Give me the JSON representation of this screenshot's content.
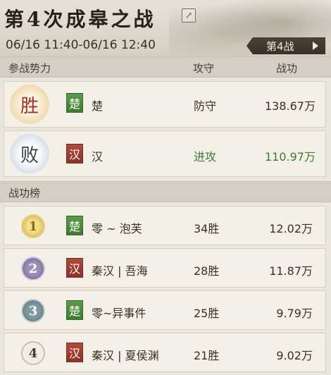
{
  "header": {
    "title": "第4次成皋之战",
    "time_range": "06/16 11:40-06/16 12:40",
    "battle_button": "第4战"
  },
  "participants": {
    "columns": [
      "参战势力",
      "攻守",
      "战功"
    ],
    "rows": [
      {
        "result": "胜",
        "tag": "楚",
        "name": "楚",
        "role": "防守",
        "merit": "138.67万",
        "role_color": "#4a3c30"
      },
      {
        "result": "败",
        "tag": "汉",
        "name": "汉",
        "role": "进攻",
        "merit": "110.97万",
        "role_color": "#3f7a32"
      }
    ]
  },
  "ranking": {
    "title": "战功榜",
    "rows": [
      {
        "rank": "1",
        "tag": "楚",
        "name": "零 ~ 泡芙",
        "wins": "34胜",
        "merit": "12.02万"
      },
      {
        "rank": "2",
        "tag": "汉",
        "name": "秦汉 | 吾海",
        "wins": "28胜",
        "merit": "11.87万"
      },
      {
        "rank": "3",
        "tag": "楚",
        "name": "零~异事件",
        "wins": "25胜",
        "merit": "9.79万"
      },
      {
        "rank": "4",
        "tag": "汉",
        "name": "秦汉 | 夏侯渊",
        "wins": "21胜",
        "merit": "9.02万"
      }
    ]
  },
  "icons": {
    "share": "share-icon",
    "arrow": "arrow-right-icon"
  }
}
